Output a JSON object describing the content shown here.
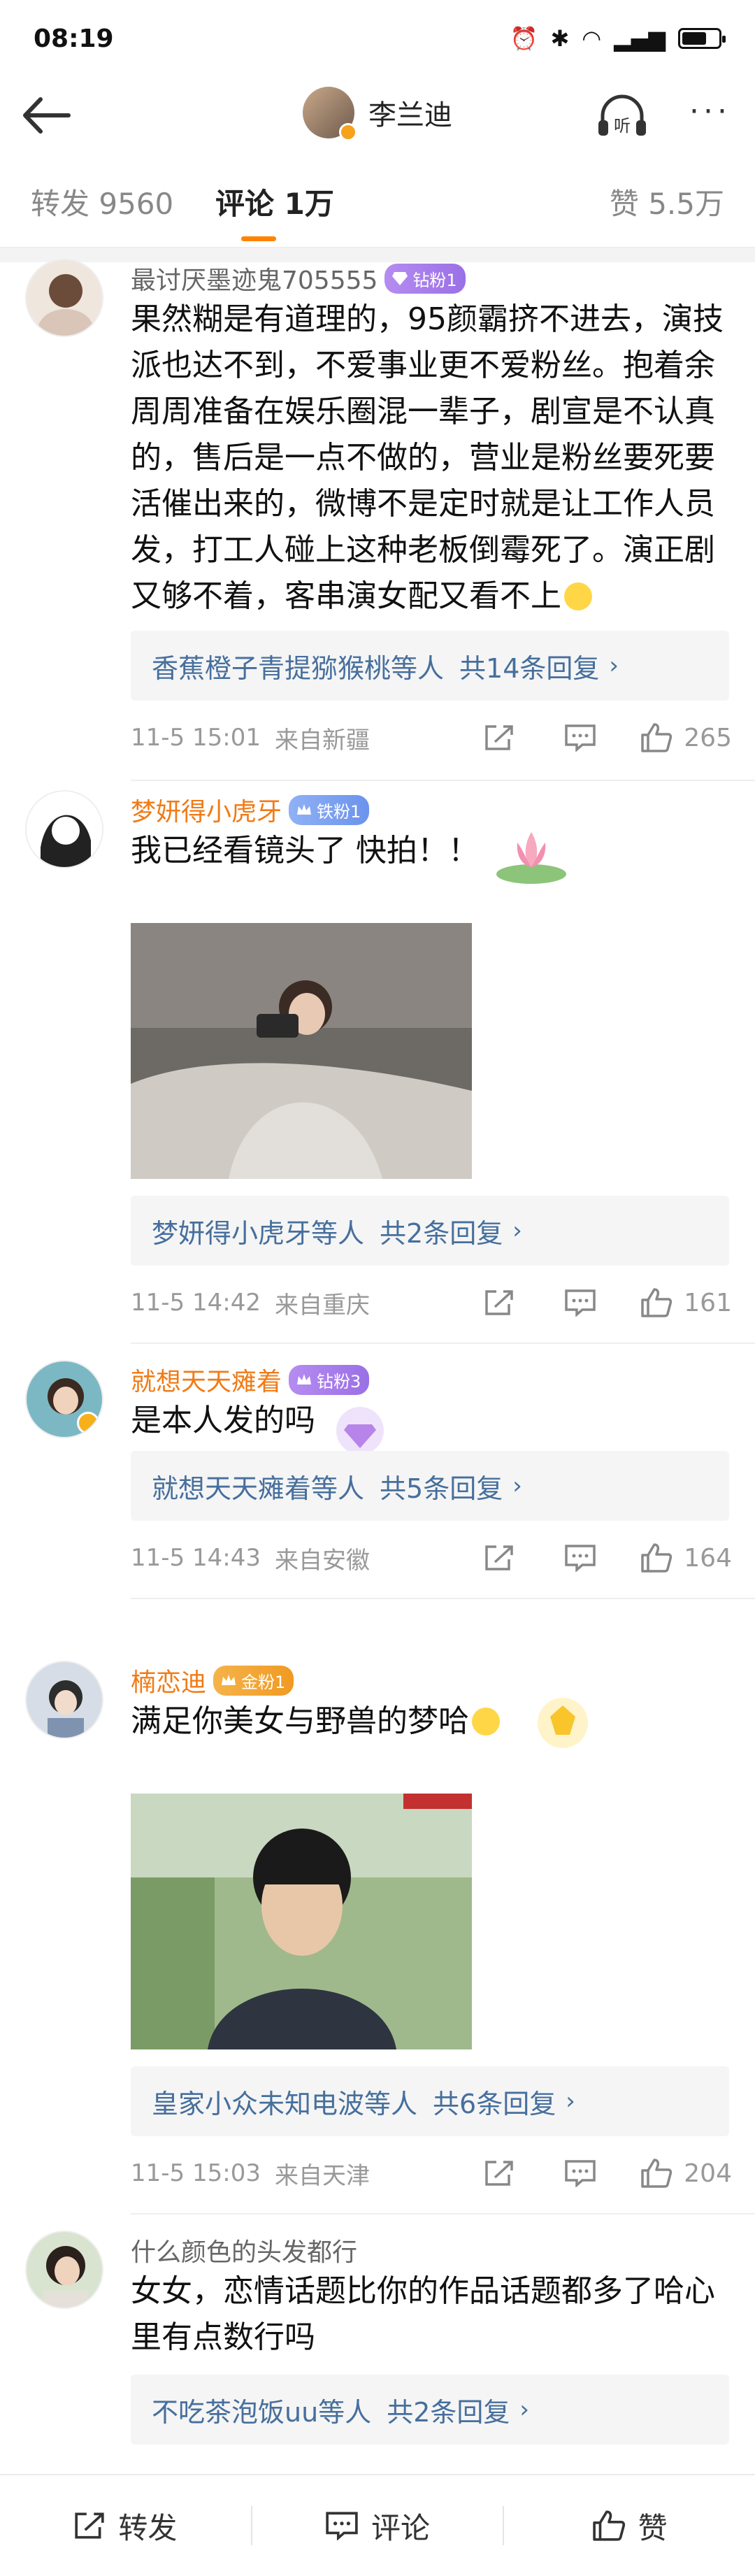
{
  "status_bar": {
    "time": "08:19",
    "battery_level": 0.6
  },
  "nav": {
    "title": "李兰迪",
    "listen_label": "听",
    "more_label": "···"
  },
  "tabs": [
    {
      "label": "转发 9560"
    },
    {
      "label": "评论 1万"
    },
    {
      "label": "赞 5.5万"
    }
  ],
  "comments": [
    {
      "name": "最讨厌墨迹鬼705555",
      "badge": "钻粉1",
      "text": "果然糊是有道理的，95颜霸挤不进去，演技派也达不到，不爱事业更不爱粉丝。抱着余周周准备在娱乐圈混一辈子，剧宣是不认真的，售后是一点不做的，营业是粉丝要死要活催出来的，微博不是定时就是让工作人员发，打工人碰上这种老板倒霉死了。演正剧又够不着，客串演女配又看不上",
      "reply_users": "香蕉橙子青提猕猴桃",
      "reply_suffix": "等人",
      "reply_count": "共14条回复",
      "time": "11-5 15:01",
      "location": "来自新疆",
      "likes": "265"
    },
    {
      "name": "梦妍得小虎牙",
      "badge": "铁粉1",
      "text": "我已经看镜头了 快拍！！",
      "reply_users": "梦妍得小虎牙",
      "reply_suffix": "等人",
      "reply_count": "共2条回复",
      "time": "11-5 14:42",
      "location": "来自重庆",
      "likes": "161"
    },
    {
      "name": "就想天天瘫着",
      "badge": "钻粉3",
      "text": "是本人发的吗",
      "reply_users": "就想天天瘫着",
      "reply_suffix": "等人",
      "reply_count": "共5条回复",
      "time": "11-5 14:43",
      "location": "来自安徽",
      "likes": "164"
    },
    {
      "name": "楠恋迪",
      "badge": "金粉1",
      "text": "满足你美女与野兽的梦哈",
      "reply_users": "皇家小众未知电波",
      "reply_suffix": "等人",
      "reply_count": "共6条回复",
      "time": "11-5 15:03",
      "location": "来自天津",
      "likes": "204"
    },
    {
      "name": "什么颜色的头发都行",
      "text": "女女，恋情话题比你的作品话题都多了哈心里有点数行吗",
      "reply_users": "不吃茶泡饭uu",
      "reply_suffix": "等人",
      "reply_count": "共2条回复"
    }
  ],
  "bottom_bar": {
    "repost": "转发",
    "comment": "评论",
    "like": "赞"
  },
  "colors": {
    "accent": "#ff8200",
    "link": "#466f9d",
    "vip_name": "#f07b16"
  }
}
